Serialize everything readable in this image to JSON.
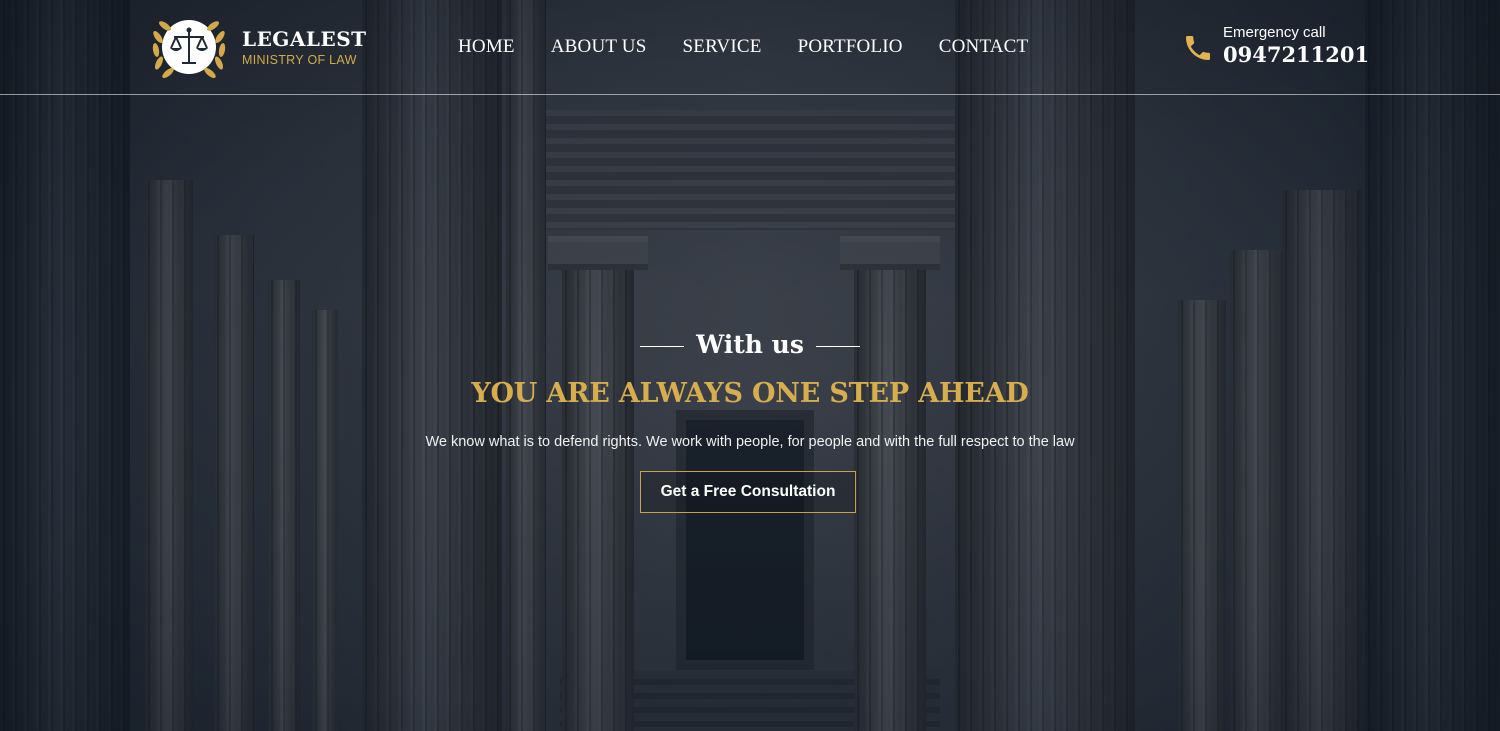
{
  "brand": {
    "name": "LEGALEST",
    "subtitle": "MINISTRY OF LAW",
    "logo_icon": "scales-of-justice-laurel-icon"
  },
  "nav": {
    "items": [
      {
        "label": "HOME"
      },
      {
        "label": "ABOUT US"
      },
      {
        "label": "SERVICE"
      },
      {
        "label": "PORTFOLIO"
      },
      {
        "label": "CONTACT"
      }
    ]
  },
  "emergency": {
    "label": "Emergency call",
    "number": "0947211201",
    "icon": "phone-icon"
  },
  "hero": {
    "eyebrow": "With us",
    "headline": "YOU ARE ALWAYS ONE STEP AHEAD",
    "tagline": "We know what is to defend rights. We work with people, for people and with the full respect to the law",
    "cta_label": "Get a Free Consultation"
  },
  "colors": {
    "accent_gold": "#d7ad4e",
    "text_white": "#ffffff",
    "overlay_navy": "#1f2833"
  }
}
